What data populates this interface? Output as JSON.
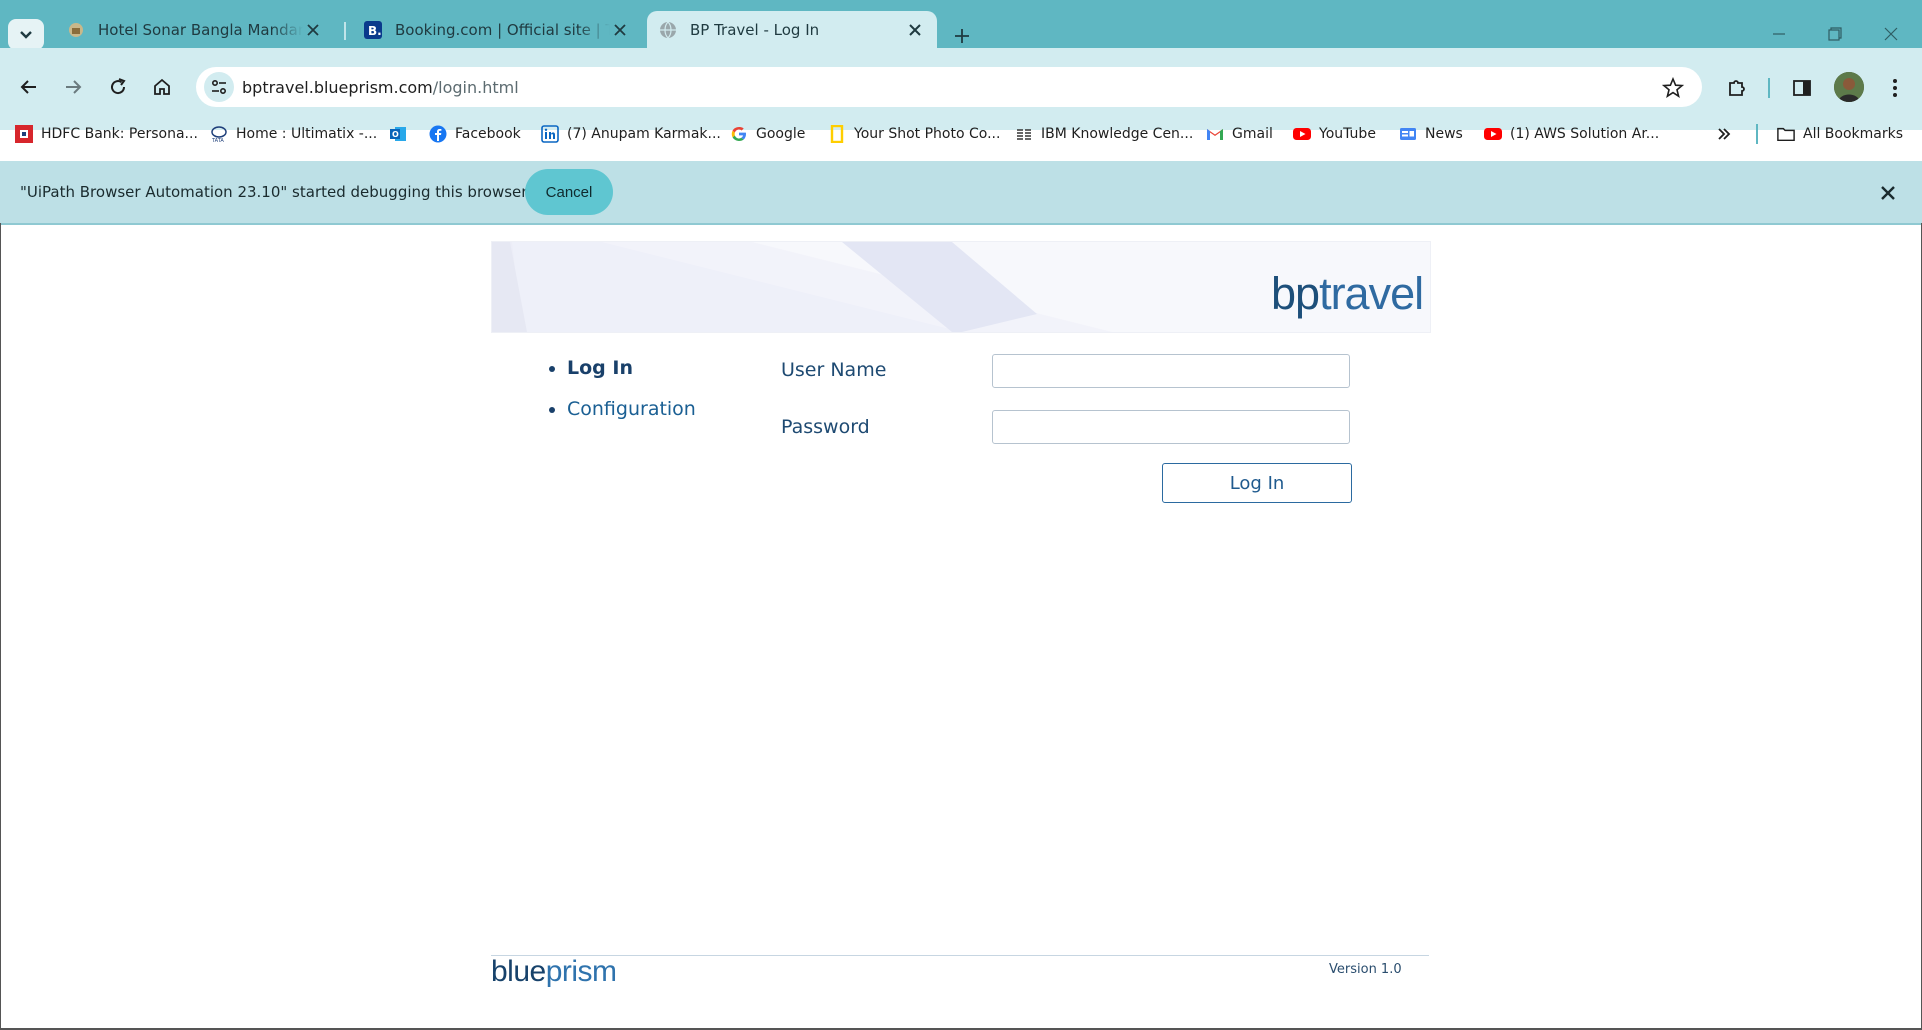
{
  "browser": {
    "tabs": [
      {
        "title": "Hotel Sonar Bangla Mandarmoni",
        "icon": "hotel-favicon",
        "active": false
      },
      {
        "title": "Booking.com | Official site | The best hotels",
        "icon": "booking-favicon",
        "active": false
      },
      {
        "title": "BP Travel - Log In",
        "icon": "globe-favicon",
        "active": true
      }
    ],
    "url_host": "bptravel.blueprism.com",
    "url_path": "/login.html",
    "bookmarks": [
      {
        "label": "HDFC Bank: Persona...",
        "icon": "hdfc-icon",
        "color": "#d7262c"
      },
      {
        "label": "Home : Ultimatix -...",
        "icon": "tata-icon",
        "color": "#1f3f7a"
      },
      {
        "label": "",
        "icon": "outlook-icon",
        "color": "#0a64b8"
      },
      {
        "label": "Facebook",
        "icon": "facebook-icon",
        "color": "#1877f2"
      },
      {
        "label": "(7) Anupam Karmak...",
        "icon": "linkedin-icon",
        "color": "#0a66c2"
      },
      {
        "label": "Google",
        "icon": "google-icon",
        "color": "#4285f4"
      },
      {
        "label": "Your Shot Photo Co...",
        "icon": "natgeo-icon",
        "color": "#ffce00"
      },
      {
        "label": "IBM Knowledge Cen...",
        "icon": "ibm-icon",
        "color": "#333333"
      },
      {
        "label": "Gmail",
        "icon": "gmail-icon",
        "color": "#ea4335"
      },
      {
        "label": "YouTube",
        "icon": "youtube-icon",
        "color": "#ff0000"
      },
      {
        "label": "News",
        "icon": "news-icon",
        "color": "#4285f4"
      },
      {
        "label": "(1) AWS Solution Ar...",
        "icon": "youtube-icon",
        "color": "#ff0000"
      }
    ],
    "all_bookmarks_label": "All Bookmarks",
    "infobar": {
      "message": "\"UiPath Browser Automation 23.10\" started debugging this browser",
      "cancel_label": "Cancel"
    }
  },
  "page": {
    "logo_bp": "bp",
    "logo_travel": "travel",
    "nav": [
      {
        "label": "Log In",
        "current": true
      },
      {
        "label": "Configuration",
        "current": false
      }
    ],
    "form": {
      "username_label": "User Name",
      "username_value": "",
      "password_label": "Password",
      "password_value": "",
      "submit_label": "Log In"
    },
    "footer": {
      "logo_blue": "blue",
      "logo_prism": "prism",
      "version": "Version 1.0"
    }
  }
}
